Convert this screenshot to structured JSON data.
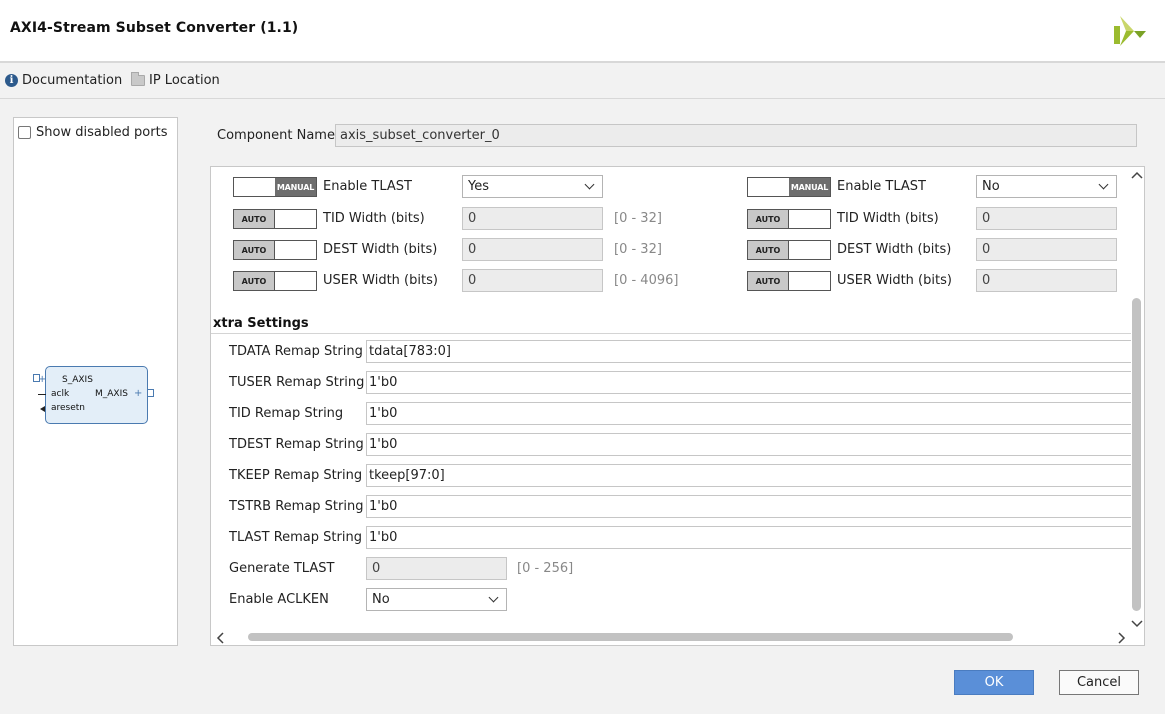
{
  "window": {
    "title": "AXI4-Stream Subset Converter (1.1)"
  },
  "toolbar": {
    "documentation_label": "Documentation",
    "ip_location_label": "IP Location"
  },
  "left_panel": {
    "show_disabled_ports_label": "Show disabled ports",
    "show_disabled_ports_checked": false,
    "block": {
      "s_axis": "S_AXIS",
      "aclk": "aclk",
      "aresetn": "aresetn",
      "m_axis": "M_AXIS"
    }
  },
  "component": {
    "label": "Component Name",
    "value": "axis_subset_converter_0"
  },
  "slave_params": {
    "enable_tlast": {
      "mode": "MANUAL",
      "label": "Enable TLAST",
      "value": "Yes"
    },
    "tid_width": {
      "mode": "AUTO",
      "label": "TID Width (bits)",
      "value": "0",
      "range": "[0 - 32]"
    },
    "dest_width": {
      "mode": "AUTO",
      "label": "DEST Width (bits)",
      "value": "0",
      "range": "[0 - 32]"
    },
    "user_width": {
      "mode": "AUTO",
      "label": "USER Width (bits)",
      "value": "0",
      "range": "[0 - 4096]"
    }
  },
  "master_params": {
    "enable_tlast": {
      "mode": "MANUAL",
      "label": "Enable TLAST",
      "value": "No"
    },
    "tid_width": {
      "mode": "AUTO",
      "label": "TID Width (bits)",
      "value": "0"
    },
    "dest_width": {
      "mode": "AUTO",
      "label": "DEST Width (bits)",
      "value": "0"
    },
    "user_width": {
      "mode": "AUTO",
      "label": "USER Width (bits)",
      "value": "0"
    }
  },
  "extra_settings": {
    "header": "xtra Settings",
    "tdata_remap": {
      "label": "TDATA Remap String",
      "value": "tdata[783:0]"
    },
    "tuser_remap": {
      "label": "TUSER Remap String",
      "value": "1'b0"
    },
    "tid_remap": {
      "label": "TID Remap String",
      "value": "1'b0"
    },
    "tdest_remap": {
      "label": "TDEST Remap String",
      "value": "1'b0"
    },
    "tkeep_remap": {
      "label": "TKEEP Remap String",
      "value": "tkeep[97:0]"
    },
    "tstrb_remap": {
      "label": "TSTRB Remap String",
      "value": "1'b0"
    },
    "tlast_remap": {
      "label": "TLAST Remap String",
      "value": "1'b0"
    },
    "generate_tlast": {
      "label": "Generate TLAST",
      "value": "0",
      "range": "[0 - 256]"
    },
    "enable_aclken": {
      "label": "Enable ACLKEN",
      "value": "No"
    }
  },
  "buttons": {
    "ok": "OK",
    "cancel": "Cancel"
  },
  "colors": {
    "ok_button": "#5a8fd8",
    "block_fill": "#e3eef8",
    "block_border": "#4a7ab0",
    "logo_green": "#9bbb2f"
  },
  "icons": [
    "info-icon",
    "folder-icon",
    "xilinx-logo",
    "chevron-down-icon",
    "scroll-arrow-icon"
  ]
}
